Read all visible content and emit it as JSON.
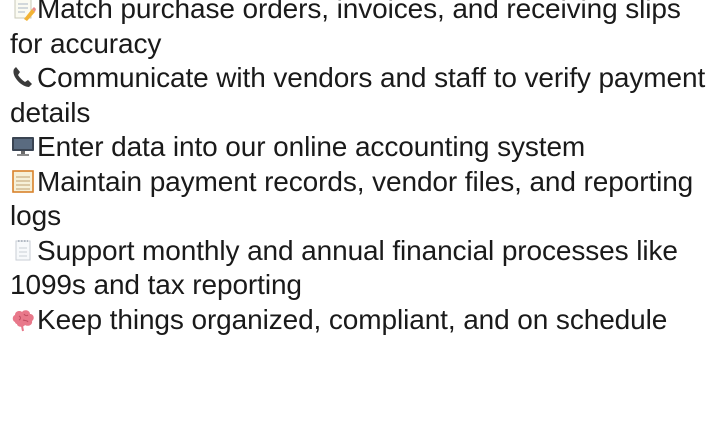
{
  "items": [
    {
      "icon": "memo-icon",
      "text": "Match purchase orders, invoices, and receiving slips for accuracy"
    },
    {
      "icon": "telephone-receiver-icon",
      "text": "Communicate with vendors and staff to verify payment details"
    },
    {
      "icon": "desktop-computer-icon",
      "text": "Enter data into our online accounting system"
    },
    {
      "icon": "ledger-icon",
      "text": "Maintain payment records, vendor files, and reporting logs"
    },
    {
      "icon": "calendar-spiral-icon",
      "text": "Support monthly and annual financial processes like 1099s and tax reporting"
    },
    {
      "icon": "brain-icon",
      "text": "Keep things organized, compliant, and on schedule"
    }
  ]
}
